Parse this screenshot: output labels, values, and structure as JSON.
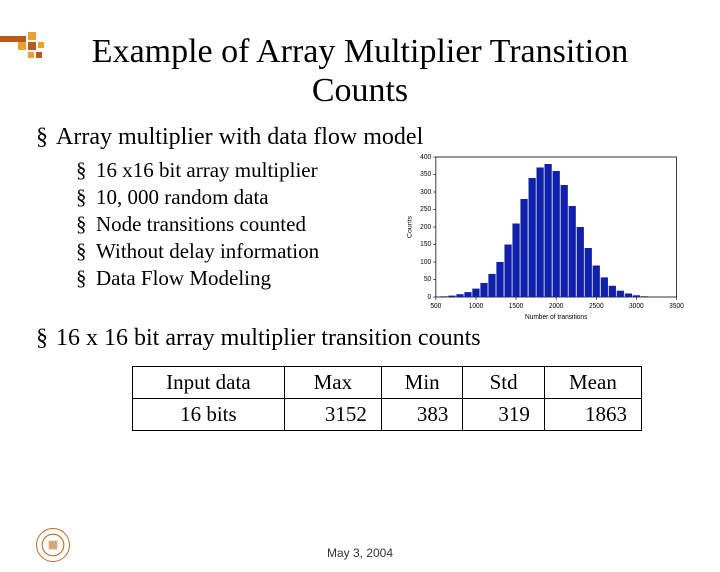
{
  "title_line1": "Example of Array Multiplier Transition",
  "title_line2": "Counts",
  "bullet1": "Array multiplier with data flow model",
  "sub": {
    "a": "16 x16 bit array multiplier",
    "b": "10, 000 random data",
    "c": "Node transitions counted",
    "d": "Without delay information",
    "e": "Data Flow Modeling"
  },
  "bullet2": "16 x 16 bit array multiplier transition counts",
  "table": {
    "h1": "Input data",
    "h2": "Max",
    "h3": "Min",
    "h4": "Std",
    "h5": "Mean",
    "r1": "16 bits",
    "r2": "3152",
    "r3": "383",
    "r4": "319",
    "r5": "1863"
  },
  "footer_date": "May 3, 2004",
  "chart_data": {
    "type": "bar",
    "title": "",
    "xlabel": "Number of transitions",
    "ylabel": "Counts",
    "xlim": [
      500,
      3500
    ],
    "ylim": [
      0,
      400
    ],
    "xticks": [
      500,
      1000,
      1500,
      2000,
      2500,
      3000,
      3500
    ],
    "yticks": [
      0,
      50,
      100,
      150,
      200,
      250,
      300,
      350,
      400
    ],
    "categories": [
      600,
      700,
      800,
      900,
      1000,
      1100,
      1200,
      1300,
      1400,
      1500,
      1600,
      1700,
      1800,
      1900,
      2000,
      2100,
      2200,
      2300,
      2400,
      2500,
      2600,
      2700,
      2800,
      2900,
      3000,
      3100
    ],
    "values": [
      2,
      4,
      8,
      14,
      24,
      40,
      66,
      100,
      150,
      210,
      280,
      340,
      370,
      380,
      360,
      320,
      260,
      200,
      140,
      90,
      56,
      32,
      18,
      10,
      5,
      2
    ]
  }
}
